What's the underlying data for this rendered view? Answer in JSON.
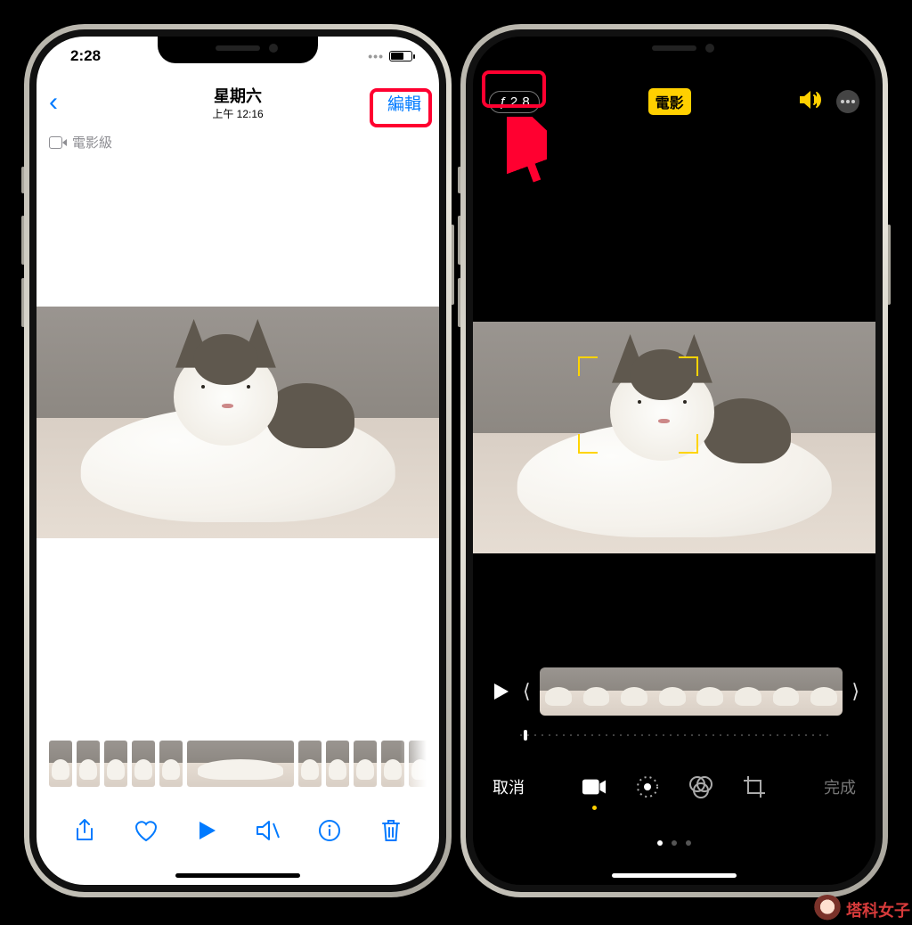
{
  "left": {
    "status_time": "2:28",
    "nav": {
      "title": "星期六",
      "subtitle": "上午 12:16",
      "edit": "編輯"
    },
    "badge": "電影級",
    "toolbar": {
      "share": "share-icon",
      "favorite": "heart-icon",
      "play": "play-icon",
      "mute": "mute-icon",
      "info": "info-icon",
      "delete": "trash-icon"
    }
  },
  "right": {
    "fstop": "ƒ 2.8",
    "mode_chip": "電影",
    "cancel": "取消",
    "done": "完成",
    "tools": [
      "video",
      "adjust",
      "filters",
      "crop"
    ]
  },
  "watermark": "塔科女子"
}
